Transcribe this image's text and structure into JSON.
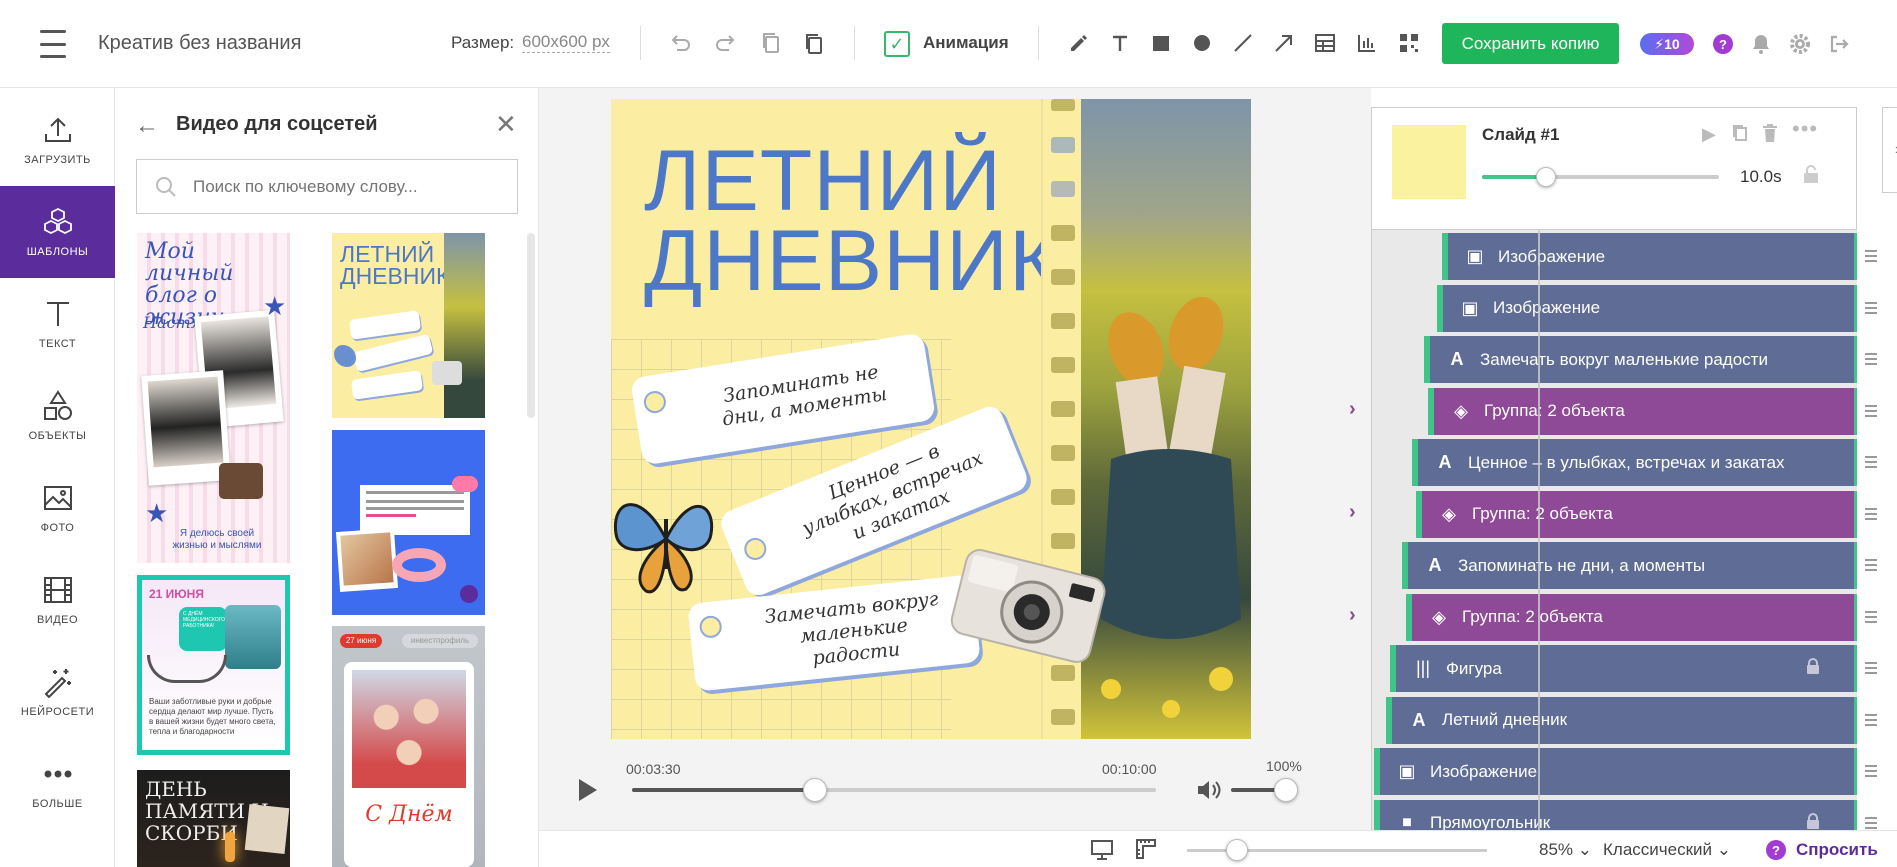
{
  "header": {
    "doc_title": "Креатив без названия",
    "size_label": "Размер:",
    "size_value": "600x600",
    "size_unit": "px",
    "animation_label": "Анимация",
    "animation_checked": true,
    "save_label": "Сохранить копию",
    "credits": "⚡10",
    "help_glyph": "?"
  },
  "sidebar": {
    "items": [
      {
        "label": "ЗАГРУЗИТЬ",
        "icon": "upload-icon"
      },
      {
        "label": "ШАБЛОНЫ",
        "icon": "cubes-icon",
        "active": true
      },
      {
        "label": "ТЕКСТ",
        "icon": "text-icon"
      },
      {
        "label": "ОБЪЕКТЫ",
        "icon": "shapes-icon"
      },
      {
        "label": "ФОТО",
        "icon": "photo-icon"
      },
      {
        "label": "ВИДЕО",
        "icon": "film-icon"
      },
      {
        "label": "НЕЙРОСЕТИ",
        "icon": "magic-wand-icon"
      },
      {
        "label": "БОЛЬШЕ",
        "icon": "more-icon"
      }
    ]
  },
  "template_panel": {
    "title": "Видео для соцсетей",
    "search_placeholder": "Поиск по ключевому слову...",
    "thumbs": {
      "blog_title": "Мой личный блог о жизни",
      "blog_name": "Настя",
      "blog_footer": "Я делюсь своей жизнью и мыслями",
      "diary_title": "ЛЕТНИЙ ДНЕВНИК",
      "june_date": "21 ИЮНЯ",
      "june_badge": "С ДНЁМ МЕДИЦИНСКОГО РАБОТНИКА!",
      "june_body": "Ваши заботливые руки и добрые сердца делают мир лучше. Пусть в вашей жизни будет много света, тепла и благодарности",
      "memory_title": "ДЕНЬ ПАМЯТИ И СКОРБИ",
      "friends_date": "27 июня",
      "friends_tag": "инвестпрофиль",
      "friends_title": "С Днём"
    }
  },
  "slide": {
    "title_line1": "ЛЕТНИЙ",
    "title_line2": "ДНЕВНИК",
    "tag1": "Запоминать не дни, а моменты",
    "tag2": "Ценное — в улыбках, встречах и закатах",
    "tag3": "Замечать вокруг маленькие радости",
    "bg_color": "#fbeea2",
    "title_color": "#4d78c8"
  },
  "timeline": {
    "current_time": "00:03:30",
    "total_time": "00:10:00",
    "volume": "100%",
    "progress": 0.35
  },
  "bottombar": {
    "zoom": "85%",
    "mode": "Классический",
    "ask_label": "Спросить"
  },
  "layers": {
    "slide_name": "Слайд #1",
    "duration": "10.0s",
    "items": [
      {
        "label": "Изображение",
        "type": "obj",
        "icon": "image-icon",
        "expand": false,
        "locked": false
      },
      {
        "label": "Изображение",
        "type": "obj",
        "icon": "image-icon",
        "expand": false,
        "locked": false
      },
      {
        "label": "Замечать вокруг маленькие радости",
        "type": "obj",
        "icon": "text-icon",
        "expand": false,
        "locked": false
      },
      {
        "label": "Группа: 2 объекта",
        "type": "grp",
        "icon": "layers-icon",
        "expand": true,
        "locked": false
      },
      {
        "label": "Ценное – в улыбках, встречах и закатах",
        "type": "obj",
        "icon": "text-icon",
        "expand": false,
        "locked": false
      },
      {
        "label": "Группа: 2 объекта",
        "type": "grp",
        "icon": "layers-icon",
        "expand": true,
        "locked": false
      },
      {
        "label": "Запоминать не дни, а моменты",
        "type": "obj",
        "icon": "text-icon",
        "expand": false,
        "locked": false
      },
      {
        "label": "Группа: 2 объекта",
        "type": "grp",
        "icon": "layers-icon",
        "expand": true,
        "locked": false
      },
      {
        "label": "Фигура",
        "type": "obj",
        "icon": "barcode-icon",
        "expand": false,
        "locked": true
      },
      {
        "label": "Летний дневник",
        "type": "obj",
        "icon": "text-icon",
        "expand": false,
        "locked": false
      },
      {
        "label": "Изображение",
        "type": "obj",
        "icon": "image-icon",
        "expand": false,
        "locked": false
      },
      {
        "label": "Прямоугольник",
        "type": "obj",
        "icon": "square-icon",
        "expand": false,
        "locked": true
      }
    ]
  }
}
